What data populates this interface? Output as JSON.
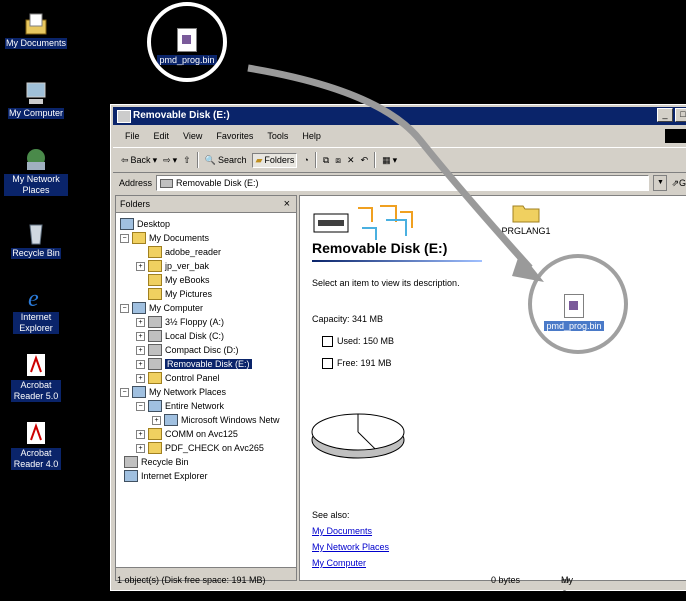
{
  "desktop": {
    "icons": [
      {
        "label": "My Documents"
      },
      {
        "label": "My Computer"
      },
      {
        "label": "My Network Places"
      },
      {
        "label": "Recycle Bin"
      },
      {
        "label": "Internet Explorer"
      },
      {
        "label": "Acrobat Reader 5.0"
      },
      {
        "label": "Acrobat Reader 4.0"
      }
    ],
    "dragged_file": "pmd_prog.bin"
  },
  "window": {
    "title": "Removable Disk (E:)",
    "menu": [
      "File",
      "Edit",
      "View",
      "Favorites",
      "Tools",
      "Help"
    ],
    "toolbar": {
      "back": "Back",
      "search": "Search",
      "folders": "Folders"
    },
    "address_label": "Address",
    "address_value": "Removable Disk (E:)",
    "go": "Go"
  },
  "folders_pane": {
    "header": "Folders",
    "close": "×",
    "tree": [
      "Desktop",
      "My Documents",
      "adobe_reader",
      "jp_ver_bak",
      "My eBooks",
      "My Pictures",
      "My Computer",
      "3½ Floppy (A:)",
      "Local Disk (C:)",
      "Compact Disc (D:)",
      "Removable Disk (E:)",
      "Control Panel",
      "My Network Places",
      "Entire Network",
      "Microsoft Windows Netw",
      "COMM on Avc125",
      "PDF_CHECK on Avc265",
      "Recycle Bin",
      "Internet Explorer"
    ]
  },
  "content": {
    "title": "Removable Disk (E:)",
    "hint": "Select an item to view its description.",
    "capacity": "Capacity: 341 MB",
    "used": "Used: 150 MB",
    "free": "Free: 191 MB",
    "used_fraction": 0.44,
    "see_also": "See also:",
    "links": [
      "My Documents",
      "My Network Places",
      "My Computer"
    ],
    "folder_label": "PRGLANG1",
    "file_label": "pmd_prog.bin"
  },
  "status": {
    "left": "1 object(s) (Disk free space: 191 MB)",
    "size": "0 bytes",
    "zone": "My Computer"
  }
}
